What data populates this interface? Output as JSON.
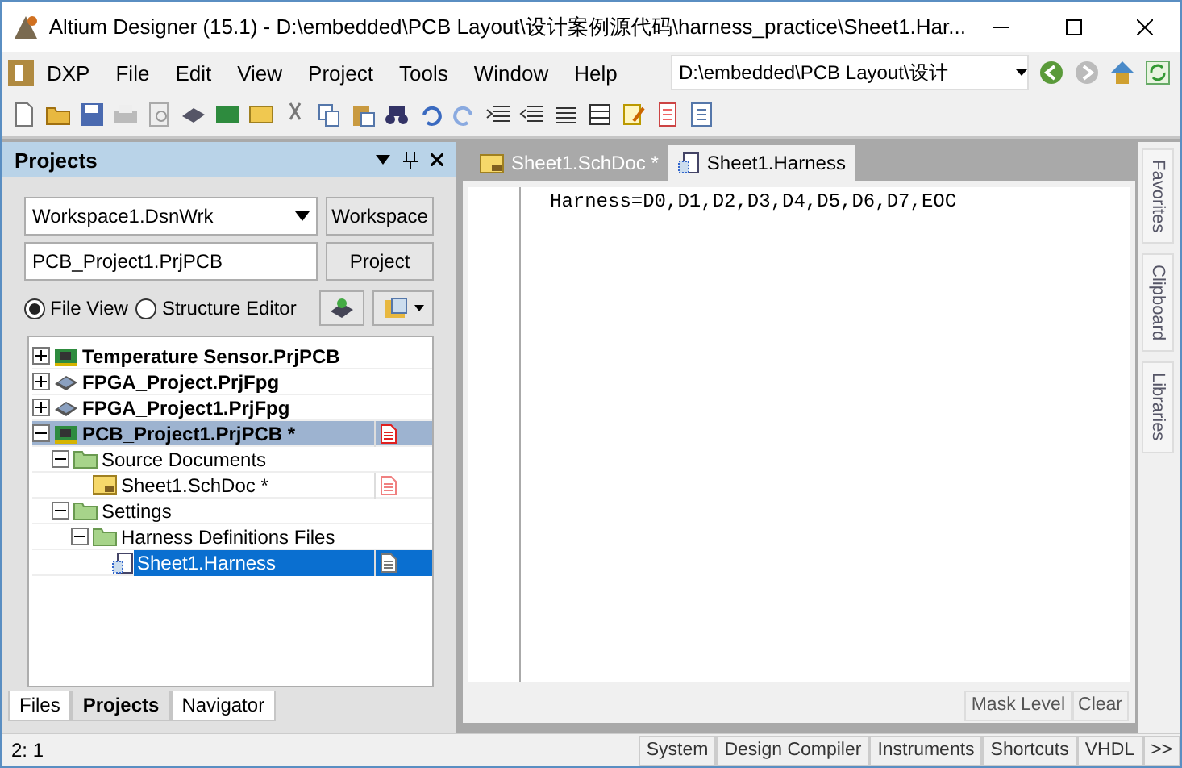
{
  "window": {
    "title": "Altium Designer (15.1) - D:\\embedded\\PCB Layout\\设计案例源代码\\harness_practice\\Sheet1.Har..."
  },
  "menu": [
    "DXP",
    "File",
    "Edit",
    "View",
    "Project",
    "Tools",
    "Window",
    "Help"
  ],
  "path_combo": {
    "value": "D:\\embedded\\PCB Layout\\设计"
  },
  "panel": {
    "title": "Projects",
    "workspace": {
      "value": "Workspace1.DsnWrk",
      "button": "Workspace"
    },
    "project": {
      "value": "PCB_Project1.PrjPCB",
      "button": "Project"
    },
    "views": [
      {
        "label": "File View",
        "selected": true
      },
      {
        "label": "Structure Editor",
        "selected": false
      }
    ],
    "tree": [
      {
        "label": "Temperature Sensor.PrjPCB",
        "kind": "pcb",
        "expanded": false,
        "selected": false,
        "bold": true
      },
      {
        "label": "FPGA_Project.PrjFpg",
        "kind": "fpga",
        "expanded": false,
        "selected": false,
        "bold": true
      },
      {
        "label": "FPGA_Project1.PrjFpg",
        "kind": "fpga",
        "expanded": false,
        "selected": false,
        "bold": true
      },
      {
        "label": "PCB_Project1.PrjPCB *",
        "kind": "pcb",
        "expanded": true,
        "selected": false,
        "bold": true,
        "current": true,
        "doc_icon": {
          "color": "#e02020"
        },
        "children": [
          {
            "label": "Source Documents",
            "kind": "folder",
            "expanded": true,
            "selected": false,
            "bold": false,
            "children": [
              {
                "label": "Sheet1.SchDoc *",
                "kind": "sheet",
                "selected": false,
                "bold": false,
                "doc_icon": {
                  "color": "#f08080"
                }
              }
            ]
          },
          {
            "label": "Settings",
            "kind": "folder",
            "expanded": true,
            "selected": false,
            "bold": false,
            "children": [
              {
                "label": "Harness Definitions Files",
                "kind": "folder",
                "expanded": true,
                "selected": false,
                "bold": false,
                "children": [
                  {
                    "label": "Sheet1.Harness",
                    "kind": "harness",
                    "selected": true,
                    "bold": false,
                    "doc_icon": {
                      "color": "#777777"
                    }
                  }
                ]
              }
            ]
          }
        ]
      }
    ],
    "bottom_tabs": [
      {
        "label": "Files",
        "selected": false
      },
      {
        "label": "Projects",
        "selected": true
      },
      {
        "label": "Navigator",
        "selected": false
      }
    ]
  },
  "doc_tabs": [
    {
      "label": "Sheet1.SchDoc *",
      "kind": "sheet",
      "selected": false
    },
    {
      "label": "Sheet1.Harness",
      "kind": "harness",
      "selected": true
    }
  ],
  "editor": {
    "lines": [
      "Harness=D0,D1,D2,D3,D4,D5,D6,D7,EOC"
    ],
    "buttons": [
      "Mask Level",
      "Clear"
    ]
  },
  "side_panels": [
    "Favorites",
    "Clipboard",
    "Libraries"
  ],
  "status_bar": {
    "position": "2: 1",
    "buttons": [
      "System",
      "Design Compiler",
      "Instruments",
      "Shortcuts",
      "VHDL",
      ">>"
    ]
  }
}
